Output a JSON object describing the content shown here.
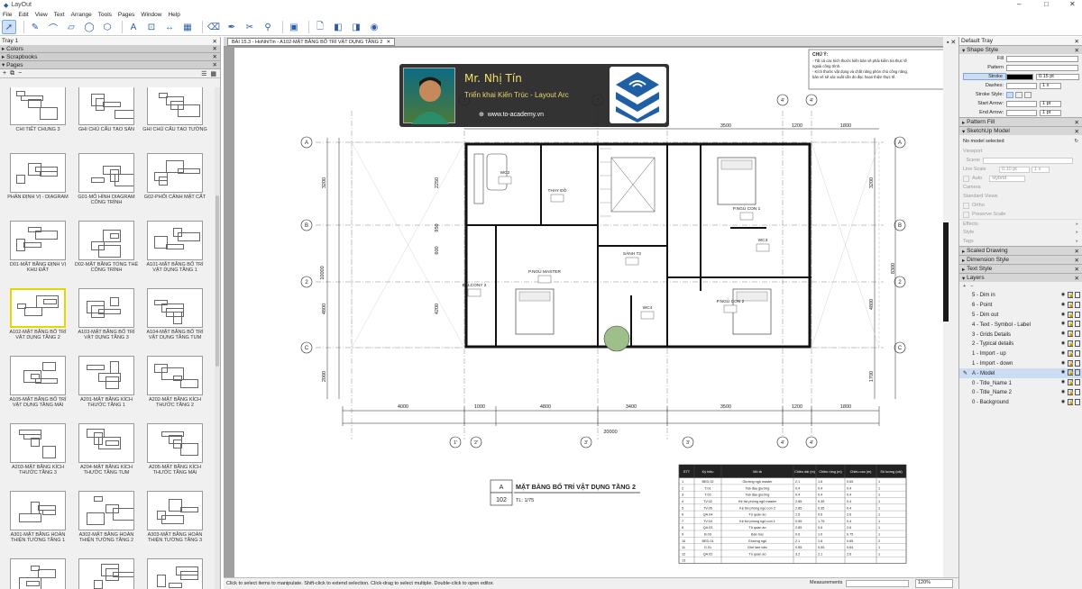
{
  "window": {
    "title": "LayOut"
  },
  "menu": [
    "File",
    "Edit",
    "View",
    "Text",
    "Arrange",
    "Tools",
    "Pages",
    "Window",
    "Help"
  ],
  "left_panel": {
    "tray_title": "Tray 1",
    "colors": "Colors",
    "scrapbooks": "Scrapbooks",
    "pages": "Pages",
    "items": [
      {
        "label": "CHI TIẾT CHUNG 3"
      },
      {
        "label": "GHI CHÚ CẤU TẠO SÀN"
      },
      {
        "label": "GHI CHÚ CẤU TẠO TƯỜNG"
      },
      {
        "label": "PHÂN ĐỊNH VỊ - DIAGRAM"
      },
      {
        "label": "G01-MÔ HÌNH DIAGRAM CÔNG TRÌNH"
      },
      {
        "label": "G02-PHỐI CẢNH MẶT CẮT"
      },
      {
        "label": "D01-MẶT BẰNG ĐỊNH VỊ KHU ĐẤT"
      },
      {
        "label": "D02-MẶT BẰNG TỔNG THỂ CÔNG TRÌNH"
      },
      {
        "label": "A101-MẶT BẰNG BỐ TRÍ VẬT DỤNG TẦNG 1"
      },
      {
        "label": "A102-MẶT BẰNG BỐ TRÍ VẬT DỤNG TẦNG 2"
      },
      {
        "label": "A103-MẶT BẰNG BỐ TRÍ VẬT DỤNG TẦNG 3"
      },
      {
        "label": "A104-MẶT BẰNG BỐ TRÍ VẬT DỤNG TẦNG TUM"
      },
      {
        "label": "A105-MẶT BẰNG BỐ TRÍ VẬT DỤNG TẦNG MÁI"
      },
      {
        "label": "A201-MẶT BẰNG KÍCH THƯỚC TẦNG 1"
      },
      {
        "label": "A202-MẶT BẰNG KÍCH THƯỚC TẦNG 2"
      },
      {
        "label": "A203-MẶT BẰNG KÍCH THƯỚC TẦNG 3"
      },
      {
        "label": "A204-MẶT BẰNG KÍCH THƯỚC TẦNG TUM"
      },
      {
        "label": "A205-MẶT BẰNG KÍCH THƯỚC TẦNG MÁI"
      },
      {
        "label": "A301-MẶT BẰNG HOÀN THIỆN TƯỜNG TẦNG 1"
      },
      {
        "label": "A302-MẶT BẰNG HOÀN THIỆN TƯỜNG TẦNG 2"
      },
      {
        "label": "A303-MẶT BẰNG HOÀN THIỆN TƯỜNG TẦNG 3"
      },
      {
        "label": ""
      },
      {
        "label": ""
      },
      {
        "label": ""
      }
    ]
  },
  "document": {
    "tab": "BÀI 15.3 - HoNhiTin - A102-MẶT BẰNG BỐ TRÍ VẬT DỤNG TẦNG 2",
    "banner": {
      "name": "Mr. Nhị Tín",
      "subtitle": "Triển khai Kiến Trúc - Layout Arc",
      "website": "www.to-academy.vn"
    },
    "note_title": "CHÚ Ý:",
    "note_lines": [
      "- Tất cả các kích thước kiến bản vẽ phải kiểm tra thực tế",
      "ngoài công trình.",
      "- Kích thước vật dụng và chất năng phòn chủ công năng,",
      "bản vẽ sẽ xác xuất cần đo đạc hoạn thiện thực tế."
    ],
    "sheet_letter": "A",
    "sheet_title": "MẶT BẰNG BỐ TRÍ VẬT DỤNG TẦNG 2",
    "sheet_no": "102",
    "sheet_scale": "TL: 1/75",
    "rooms": [
      "WC2",
      "THAY ĐỒ",
      "P.NGỦ CON 1",
      "SẢNH T2",
      "WC3",
      "BALCONY 2",
      "P.NGỦ MASTER",
      "WC4",
      "P.NGỦ CON 2"
    ],
    "top_dims": [
      "3500",
      "1200",
      "1800"
    ],
    "bottom_dims": [
      "4000",
      "1000",
      "4800",
      "3400",
      "3500",
      "1200",
      "1800"
    ],
    "total_dim": "20000",
    "right_dims": [
      "3200",
      "8300",
      "4800",
      "1700"
    ],
    "left_dims": [
      "3200",
      "2250",
      "950",
      "600",
      "10000",
      "4800",
      "4200",
      "2000"
    ],
    "grid_rows": [
      "A",
      "B",
      "2",
      "C"
    ],
    "grid_cols": [
      "1",
      "2",
      "3",
      "4",
      "4'",
      "5",
      "1'",
      "2'",
      "3'",
      "4'",
      "5'"
    ],
    "table_headers": [
      "STT",
      "Ký hiệu",
      "Mô tả",
      "Chiều dài (m)",
      "Chiều rộng (m)",
      "Chiều cao (m)",
      "Số lượng (cái)"
    ],
    "table_rows": [
      [
        "1",
        "BED.02",
        "Giường ngủ master",
        "2.1",
        "1.6",
        "0.65",
        "1"
      ],
      [
        "2",
        "T.01",
        "Tab đầu giường",
        "0.4",
        "0.4",
        "0.4",
        "1"
      ],
      [
        "3",
        "T.02",
        "Tab đầu giường",
        "0.4",
        "0.4",
        "0.4",
        "1"
      ],
      [
        "4",
        "TV.02",
        "Kệ tivi phòng ngủ master",
        "2.85",
        "0.35",
        "0.4",
        "1"
      ],
      [
        "5",
        "TV.05",
        "Kệ tivi phòng ngủ con 2",
        "2.85",
        "0.35",
        "0.4",
        "1"
      ],
      [
        "6",
        "QA.04",
        "Tủ quần áo",
        "1.5",
        "0.6",
        "2.6",
        "1"
      ],
      [
        "7",
        "TV.04",
        "Kệ tivi phòng ngủ con 1",
        "0.55",
        "1.75",
        "0.4",
        "1"
      ],
      [
        "8",
        "QA.03",
        "Tủ quần áo",
        "2.85",
        "0.6",
        "2.6",
        "1"
      ],
      [
        "9",
        "B.03",
        "Bàn học",
        "0.6",
        "1.0",
        "0.75",
        "1"
      ],
      [
        "10",
        "BED.01",
        "Giường ngủ",
        "2.1",
        "1.6",
        "0.65",
        "2"
      ],
      [
        "11",
        "G.01",
        "Ghế làm việc",
        "0.55",
        "0.55",
        "0.64",
        "1"
      ],
      [
        "12",
        "QA.02",
        "Tủ quần áo",
        "3.2",
        "2.1",
        "2.6",
        "1"
      ],
      [
        "13",
        "",
        "",
        "",
        "",
        "",
        ""
      ]
    ]
  },
  "status": {
    "hint": "Click to select items to manipulate. Shift-click to extend selection. Click-drag to select multiple. Double-click to open editor.",
    "measurements": "Measurements",
    "zoom": "120%"
  },
  "right_panel": {
    "tray": "Default Tray",
    "shape_style": "Shape Style",
    "fill": "Fill",
    "pattern": "Pattern",
    "stroke": "Stroke",
    "stroke_val": "0.15 pt",
    "dashes": "Dashes:",
    "dash_val": "1 x",
    "stroke_style": "Stroke Style:",
    "start_arrow": "Start Arrow:",
    "start_val": "1 pt",
    "end_arrow": "End Arrow:",
    "end_val": "1 pt",
    "pattern_fill": "Pattern Fill",
    "sketchup_model": "SketchUp Model",
    "no_model": "No model selected",
    "viewport": "Viewport",
    "scene": "Scene",
    "line_scale": "Line Scale",
    "line_val": "0.10 pt",
    "line_mul": "1 x",
    "auto": "Auto",
    "hybrid": "Hybrid",
    "camera": "Camera",
    "standard_views": "Standard Views",
    "ortho": "Ortho",
    "preserve_scale": "Preserve Scale",
    "effects": "Effects",
    "style": "Style",
    "tags": "Tags",
    "scaled_drawing": "Scaled Drawing",
    "dimension_style": "Dimension Style",
    "text_style": "Text Style",
    "layers": "Layers",
    "layer_items": [
      "5 - Dim in",
      "6 - Point",
      "5 - Dim out",
      "4 - Text - Symbol - Label",
      "3 - Grids Details",
      "2 - Typical details",
      "1 - Import - up",
      "1 - Import - down",
      "A - Model",
      "0 - Title_Name 1",
      "0 - Title_Name 2",
      "0 - Background"
    ],
    "current_layer": "A - Model"
  }
}
